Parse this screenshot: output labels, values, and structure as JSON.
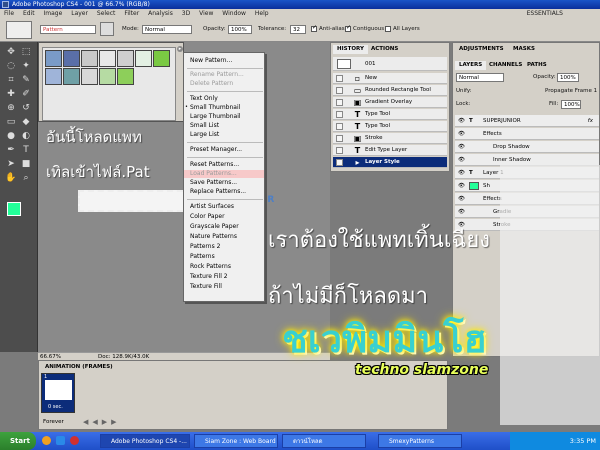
{
  "window": {
    "title": "Adobe Photoshop CS4 - 001 @ 66.7% (RGB/8)",
    "workspace": "ESSENTIALS"
  },
  "menubar": [
    "File",
    "Edit",
    "Image",
    "Layer",
    "Select",
    "Filter",
    "Analysis",
    "3D",
    "View",
    "Window",
    "Help"
  ],
  "options": {
    "pattern_label": "Pattern",
    "mode_label": "Mode:",
    "mode_value": "Normal",
    "opacity_label": "Opacity:",
    "opacity_value": "100%",
    "tolerance_label": "Tolerance:",
    "tolerance_value": "32",
    "antialias_label": "Anti-alias",
    "contiguous_label": "Contiguous",
    "alllayers_label": "All Layers"
  },
  "context_menu": [
    {
      "label": "New Pattern...",
      "state": "normal"
    },
    {
      "sep": true
    },
    {
      "label": "Rename Pattern...",
      "state": "disabled"
    },
    {
      "label": "Delete Pattern",
      "state": "disabled"
    },
    {
      "sep": true
    },
    {
      "label": "Text Only",
      "state": "normal"
    },
    {
      "label": "Small Thumbnail",
      "state": "checked"
    },
    {
      "label": "Large Thumbnail",
      "state": "normal"
    },
    {
      "label": "Small List",
      "state": "normal"
    },
    {
      "label": "Large List",
      "state": "normal"
    },
    {
      "sep": true
    },
    {
      "label": "Preset Manager...",
      "state": "normal"
    },
    {
      "sep": true
    },
    {
      "label": "Reset Patterns...",
      "state": "normal"
    },
    {
      "label": "Load Patterns...",
      "state": "highlight"
    },
    {
      "label": "Save Patterns...",
      "state": "normal"
    },
    {
      "label": "Replace Patterns...",
      "state": "normal"
    },
    {
      "sep": true
    },
    {
      "label": "Artist Surfaces",
      "state": "normal"
    },
    {
      "label": "Color Paper",
      "state": "normal"
    },
    {
      "label": "Grayscale Paper",
      "state": "normal"
    },
    {
      "label": "Nature Patterns",
      "state": "normal"
    },
    {
      "label": "Patterns 2",
      "state": "normal"
    },
    {
      "label": "Patterns",
      "state": "normal"
    },
    {
      "label": "Rock Patterns",
      "state": "normal"
    },
    {
      "label": "Texture Fill 2",
      "state": "normal"
    },
    {
      "label": "Texture Fill",
      "state": "normal"
    }
  ],
  "history": {
    "tabs": [
      "HISTORY",
      "ACTIONS"
    ],
    "snapshot": "001",
    "rows": [
      {
        "icon": "new",
        "label": "New"
      },
      {
        "icon": "shape",
        "label": "Rounded Rectangle Tool"
      },
      {
        "icon": "fx",
        "label": "Gradient Overlay"
      },
      {
        "icon": "T",
        "label": "Type Tool"
      },
      {
        "icon": "T",
        "label": "Type Tool"
      },
      {
        "icon": "stroke",
        "label": "Stroke"
      },
      {
        "icon": "T",
        "label": "Edit Type Layer"
      },
      {
        "icon": "style",
        "label": "Layer Style",
        "selected": true
      }
    ]
  },
  "adjustments": {
    "tabs": [
      "ADJUSTMENTS",
      "MASKS"
    ]
  },
  "layers": {
    "tabs": [
      "LAYERS",
      "CHANNELS",
      "PATHS"
    ],
    "blend": "Normal",
    "opacity_label": "Opacity:",
    "opacity": "100%",
    "unify_label": "Unify:",
    "propagate": "Propagate Frame 1",
    "lock_label": "Lock:",
    "fill_label": "Fill:",
    "fill": "100%",
    "rows": [
      {
        "type": "T",
        "name": "SUPERJUNIOR",
        "fx": "fx"
      },
      {
        "type": "sub",
        "name": "Effects"
      },
      {
        "type": "sub2",
        "name": "Drop Shadow"
      },
      {
        "type": "sub2",
        "name": "Inner Shadow"
      },
      {
        "type": "T",
        "name": "Layer 1"
      },
      {
        "type": "shape",
        "name": "Sh"
      },
      {
        "type": "sub",
        "name": "Effects"
      },
      {
        "type": "sub2",
        "name": "Gradie"
      },
      {
        "type": "sub2",
        "name": "Stroke"
      }
    ]
  },
  "doc_status": {
    "zoom": "66.67%",
    "doc": "Doc: 128.9K/43.0K"
  },
  "animation": {
    "title": "ANIMATION (FRAMES)",
    "frame_number": "1",
    "frame_delay": "0 sec.",
    "loop": "Forever"
  },
  "overlay": {
    "caption1": "อันนี้โหลดแพท",
    "caption2": "เทิลเข้าไฟล์.Pat",
    "caption3": "เราต้องใช้แพทเทิ้นเฉียง",
    "caption4": "ถ้าไม่มีก็โหลดมา",
    "brand_thai": "ชเวพิมมินโฮ",
    "brand_en": "techno slamzone"
  },
  "taskbar": {
    "start": "Start",
    "buttons": [
      "Adobe Photoshop CS4 -...",
      "Siam Zone : Web Board ...",
      "ดาวน์โหลด",
      "SmexyPatterns"
    ],
    "clock": "3:35 PM"
  },
  "colors": {
    "foreground": "#22ff99",
    "background": "#ffffff",
    "brand_cyan": "#39d0d0",
    "brand_glow": "#fff200"
  }
}
